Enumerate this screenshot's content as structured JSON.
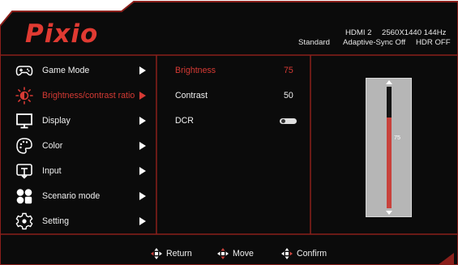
{
  "colors": {
    "accent": "#d63a34",
    "text": "#f0f0f0",
    "panel": "#0b0b0b",
    "border": "#7a1e1a"
  },
  "brand": {
    "logo_text": "Pixio"
  },
  "status": {
    "input": "HDMI 2",
    "resolution_refresh": "2560X1440  144Hz",
    "picture_mode": "Standard",
    "adaptive_sync": "Adaptive-Sync Off",
    "hdr": "HDR OFF"
  },
  "menu": {
    "items": [
      {
        "label": "Game Mode",
        "icon": "gamepad-icon",
        "active": false
      },
      {
        "label": "Brightness/contrast ratio",
        "icon": "brightness-icon",
        "active": true
      },
      {
        "label": "Display",
        "icon": "monitor-icon",
        "active": false
      },
      {
        "label": "Color",
        "icon": "palette-icon",
        "active": false
      },
      {
        "label": "Input",
        "icon": "input-source-icon",
        "active": false
      },
      {
        "label": "Scenario mode",
        "icon": "scenario-mode-icon",
        "active": false
      },
      {
        "label": "Setting",
        "icon": "settings-gear-icon",
        "active": false
      }
    ]
  },
  "submenu": {
    "brightness": {
      "label": "Brightness",
      "value": "75"
    },
    "contrast": {
      "label": "Contrast",
      "value": "50"
    },
    "dcr": {
      "label": "DCR",
      "state": "off"
    }
  },
  "slider": {
    "value": "75",
    "level": 0.75,
    "max": 100
  },
  "footer": {
    "return_label": "Return",
    "move_label": "Move",
    "confirm_label": "Confirm",
    "icon": "dpad-icon"
  }
}
